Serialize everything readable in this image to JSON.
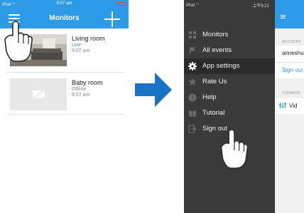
{
  "left_screen": {
    "status_bar": {
      "carrier": "iPod ⌔",
      "time": "9:07 am"
    },
    "nav": {
      "title": "Monitors"
    },
    "cameras": [
      {
        "name": "Living room",
        "status": "Live",
        "time": "9:07 am",
        "status_color": "#2e9be8"
      },
      {
        "name": "Baby room",
        "status": "Offline",
        "time": "9:07 am",
        "status_color": "#888888"
      }
    ]
  },
  "right_screen": {
    "status_bar": {
      "carrier": "iPod ⌔",
      "time": "上午9:21"
    },
    "menu": {
      "items": [
        {
          "label": "Monitors",
          "icon": "grid-icon"
        },
        {
          "label": "All events",
          "icon": "flag-icon"
        },
        {
          "label": "App settings",
          "icon": "gear-icon"
        },
        {
          "label": "Rate Us",
          "icon": "star-icon"
        },
        {
          "label": "Help",
          "icon": "question-icon"
        },
        {
          "label": "Tutorial",
          "icon": "book-icon"
        },
        {
          "label": "Sign out",
          "icon": "sign-out-icon"
        }
      ],
      "active_index": 2
    },
    "settings_behind": {
      "account_header": "ACCOUNT",
      "username": "anneshu",
      "sign_out_link": "Sign out",
      "common_header": "COMMON",
      "common_item": "Vid"
    }
  },
  "colors": {
    "accent": "#2e9be8",
    "menu_background": "#3a3a3a",
    "arrow": "#1a73c4"
  }
}
